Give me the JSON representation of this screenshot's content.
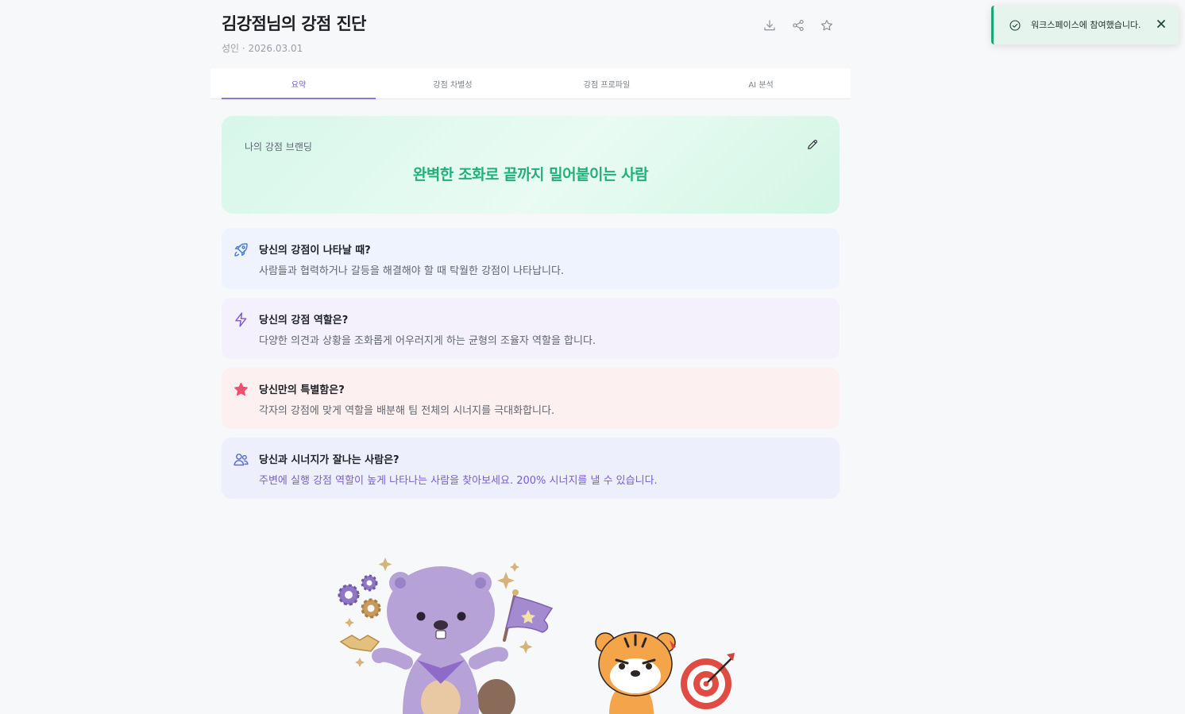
{
  "header": {
    "title": "김강점님의 강점 진단",
    "subtitle": "성인 · 2026.03.01",
    "actions": [
      {
        "icon": "download-icon"
      },
      {
        "icon": "share-icon"
      },
      {
        "icon": "star-icon"
      }
    ]
  },
  "tabs": [
    {
      "label": "요약",
      "active": true
    },
    {
      "label": "강점 차별성",
      "active": false
    },
    {
      "label": "강점 프로파일",
      "active": false
    },
    {
      "label": "AI 분석",
      "active": false
    }
  ],
  "branding": {
    "label": "나의 강점 브랜딩",
    "text": "완벽한 조화로 끝까지 밀어붙이는 사람",
    "edit_icon": "pencil-icon"
  },
  "cards": [
    {
      "icon": "rocket-icon",
      "title": "당신의 강점이 나타날 때?",
      "desc": "사람들과 협력하거나 갈등을 해결해야 할 때 탁월한 강점이 나타납니다."
    },
    {
      "icon": "lightning-icon",
      "title": "당신의 강점 역할은?",
      "desc": "다양한 의견과 상황을 조화롭게 어우러지게 하는 균형의 조율자 역할을 합니다."
    },
    {
      "icon": "star-filled-icon",
      "title": "당신만의 특별함은?",
      "desc": "각자의 강점에 맞게 역할을 배분해 팀 전체의 시너지를 극대화합니다."
    },
    {
      "icon": "users-icon",
      "title": "당신과 시너지가 잘나는 사람은?",
      "desc": "주변에 실행 강점 역할이 높게 나타나는 사람을 찾아보세요. 200% 시너지를 낼 수 있습니다."
    }
  ],
  "toast": {
    "text": "워크스페이스에 참여했습니다.",
    "icon": "check-circle-icon"
  },
  "colors": {
    "accent_purple": "#8d74d8",
    "brand_green": "#22b07a",
    "toast_green": "#1aa772"
  }
}
